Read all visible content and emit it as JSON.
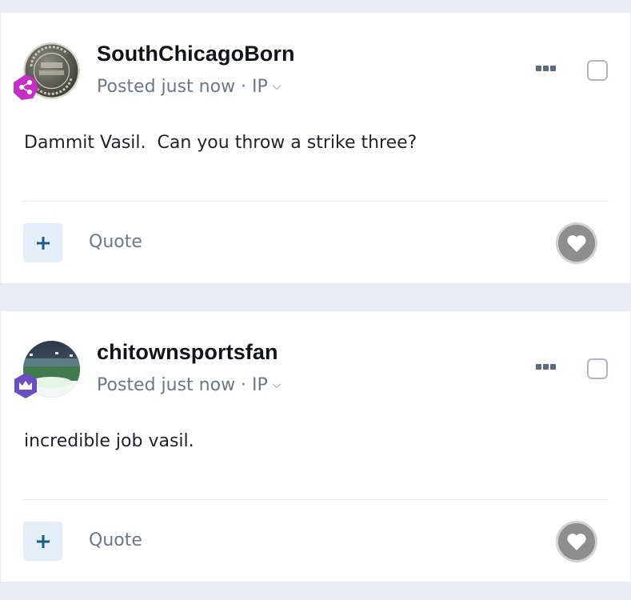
{
  "posts": [
    {
      "username": "SouthChicagoBorn",
      "meta": "Posted just now · IP",
      "content": "Dammit Vasil.  Can you throw a strike three?",
      "avatar": "vintage-token-coin-avatar",
      "badge": "magenta-share-badge-icon",
      "badge_color": "#c42fc4",
      "quote_label": "Quote"
    },
    {
      "username": "chitownsportsfan",
      "meta": "Posted just now · IP",
      "content": "incredible job vasil.",
      "avatar": "baseball-stadium-photo-avatar",
      "badge": "purple-crown-badge-icon",
      "badge_color": "#6a4fc0",
      "quote_label": "Quote"
    }
  ],
  "colors": {
    "page_background": "#e9edf3",
    "plus_button_bg": "#e3eef8",
    "plus_icon": "#1d5a83",
    "muted_text": "#6b7886"
  }
}
